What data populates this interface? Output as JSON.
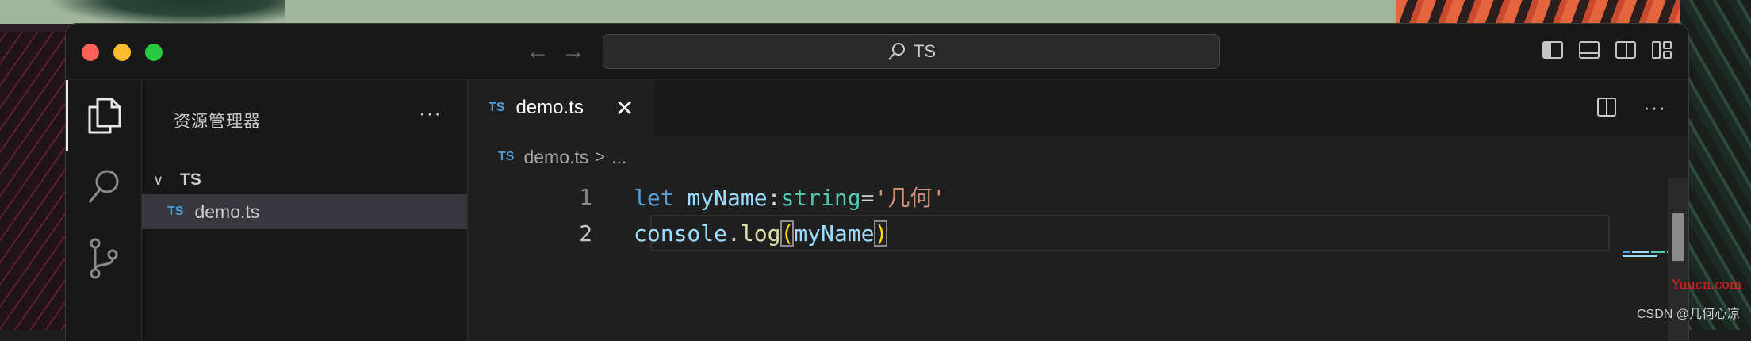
{
  "window": {
    "search_text": "TS"
  },
  "sidebar": {
    "title": "资源管理器",
    "more": "···",
    "folder": "TS",
    "file": {
      "badge": "TS",
      "name": "demo.ts"
    }
  },
  "editor": {
    "tab": {
      "badge": "TS",
      "name": "demo.ts",
      "close": "✕"
    },
    "more": "···",
    "breadcrumb": {
      "badge": "TS",
      "file": "demo.ts",
      "separator": ">",
      "rest": "..."
    },
    "lines": [
      {
        "number": "1",
        "kw": "let",
        "var": "myName",
        "colon": ":",
        "type": "string",
        "eq": "=",
        "str": "'几何'"
      },
      {
        "number": "2",
        "obj": "console",
        "dot": ".",
        "fn": "log",
        "open": "(",
        "arg": "myName",
        "close": ")"
      }
    ]
  },
  "watermarks": {
    "site": "Yuucn.com",
    "author": "CSDN @几何心凉"
  },
  "colors": {
    "keyword": "#569cd6",
    "variable": "#9cdcfe",
    "type": "#4ec9b0",
    "string": "#ce9178",
    "function": "#dcdcaa",
    "ts_badge": "#4d9bd8"
  },
  "icons": {
    "activity": [
      "files-icon",
      "search-icon",
      "source-control-icon"
    ],
    "layout": [
      "toggle-primary-sidebar-icon",
      "toggle-panel-icon",
      "toggle-secondary-sidebar-icon",
      "customize-layout-icon"
    ]
  }
}
